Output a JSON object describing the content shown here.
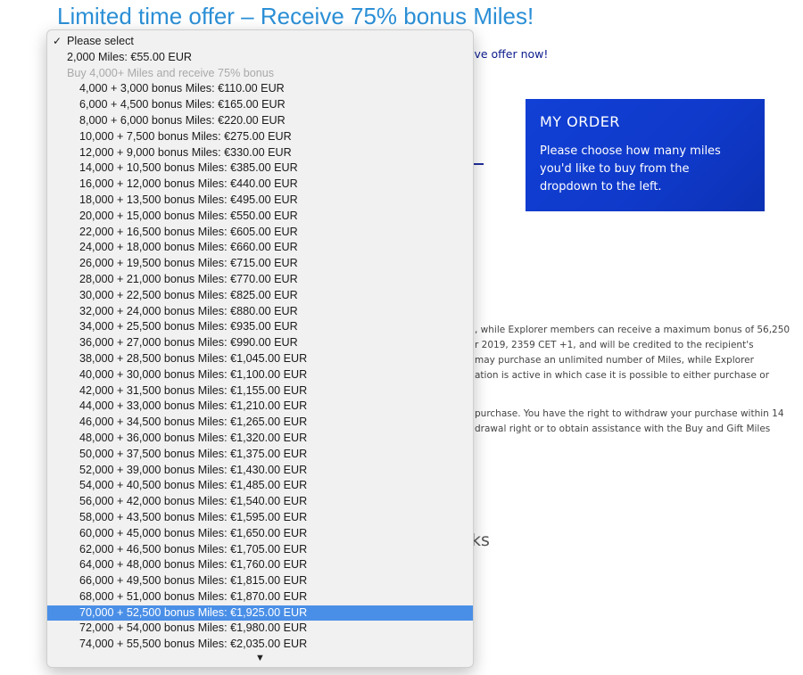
{
  "headline": "Limited time offer – Receive 75% bonus Miles!",
  "offer_link_fragment": "ive offer now!",
  "order": {
    "title": "MY ORDER",
    "text": "Please choose how many miles you'd like to buy from the dropdown to the left."
  },
  "body_lines_a": [
    ", while Explorer members can receive a maximum bonus of 56,250",
    "r 2019, 2359 CET +1, and will be credited to the recipient's",
    "may purchase an unlimited number of Miles, while Explorer",
    "ation is active in which case it is possible to either purchase or"
  ],
  "body_lines_b": [
    "purchase. You have the right to withdraw your purchase within 14",
    "drawal right or to obtain assistance with the Buy and Gift Miles"
  ],
  "section_fragment": "ks",
  "dropdown": {
    "check_glyph": "✓",
    "placeholder": "Please select",
    "base_option": "2,000 Miles: €55.00 EUR",
    "group_label": "Buy 4,000+ Miles and receive 75% bonus",
    "options": [
      "4,000 + 3,000 bonus Miles: €110.00 EUR",
      "6,000 + 4,500 bonus Miles: €165.00 EUR",
      "8,000 + 6,000 bonus Miles: €220.00 EUR",
      "10,000 + 7,500 bonus Miles: €275.00 EUR",
      "12,000 + 9,000 bonus Miles: €330.00 EUR",
      "14,000 + 10,500 bonus Miles: €385.00 EUR",
      "16,000 + 12,000 bonus Miles: €440.00 EUR",
      "18,000 + 13,500 bonus Miles: €495.00 EUR",
      "20,000 + 15,000 bonus Miles: €550.00 EUR",
      "22,000 + 16,500 bonus Miles: €605.00 EUR",
      "24,000 + 18,000 bonus Miles: €660.00 EUR",
      "26,000 + 19,500 bonus Miles: €715.00 EUR",
      "28,000 + 21,000 bonus Miles: €770.00 EUR",
      "30,000 + 22,500 bonus Miles: €825.00 EUR",
      "32,000 + 24,000 bonus Miles: €880.00 EUR",
      "34,000 + 25,500 bonus Miles: €935.00 EUR",
      "36,000 + 27,000 bonus Miles: €990.00 EUR",
      "38,000 + 28,500 bonus Miles: €1,045.00 EUR",
      "40,000 + 30,000 bonus Miles: €1,100.00 EUR",
      "42,000 + 31,500 bonus Miles: €1,155.00 EUR",
      "44,000 + 33,000 bonus Miles: €1,210.00 EUR",
      "46,000 + 34,500 bonus Miles: €1,265.00 EUR",
      "48,000 + 36,000 bonus Miles: €1,320.00 EUR",
      "50,000 + 37,500 bonus Miles: €1,375.00 EUR",
      "52,000 + 39,000 bonus Miles: €1,430.00 EUR",
      "54,000 + 40,500 bonus Miles: €1,485.00 EUR",
      "56,000 + 42,000 bonus Miles: €1,540.00 EUR",
      "58,000 + 43,500 bonus Miles: €1,595.00 EUR",
      "60,000 + 45,000 bonus Miles: €1,650.00 EUR",
      "62,000 + 46,500 bonus Miles: €1,705.00 EUR",
      "64,000 + 48,000 bonus Miles: €1,760.00 EUR",
      "66,000 + 49,500 bonus Miles: €1,815.00 EUR",
      "68,000 + 51,000 bonus Miles: €1,870.00 EUR",
      "70,000 + 52,500 bonus Miles: €1,925.00 EUR",
      "72,000 + 54,000 bonus Miles: €1,980.00 EUR",
      "74,000 + 55,500 bonus Miles: €2,035.00 EUR"
    ],
    "highlighted_option": "70,000 + 52,500 bonus Miles: €1,925.00 EUR",
    "scroll_arrow": "▼"
  },
  "colors": {
    "headline": "#2b8fd6",
    "order_box": "#1140d6",
    "highlight": "#4a8fe7"
  }
}
